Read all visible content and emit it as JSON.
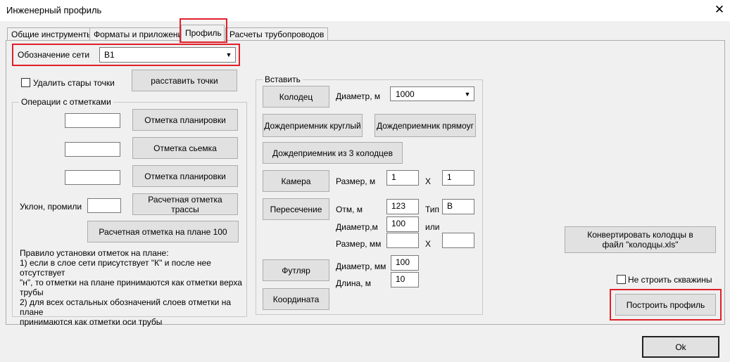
{
  "window": {
    "title": "Инженерный профиль",
    "close_glyph": "✕"
  },
  "tabs": [
    {
      "label": "Общие инструменты"
    },
    {
      "label": "Форматы и приложения"
    },
    {
      "label": "Профиль"
    },
    {
      "label": "Расчеты трубопроводов"
    }
  ],
  "network": {
    "label": "Обозначение сети",
    "value": "В1"
  },
  "top": {
    "delete_points_label": "Удалить стары точки",
    "place_points_button": "расставить точки"
  },
  "marks_group": {
    "legend": "Операции с отметками",
    "planning_button_1": "Отметка планировки",
    "survey_button": "Отметка сьемка",
    "planning_button_2": "Отметка планировки",
    "slope_label": "Уклон, промили",
    "calc_route_button": "Расчетная отметка трассы",
    "calc_plan_button": "Расчетная отметка на плане 100",
    "rule_lines": [
      "Правило установки отметок на плане:",
      "1) если в слое сети присутствует \"К\" и после нее отсутствует",
      "\"н\", то отметки на плане принимаются как отметки верха",
      "трубы",
      "2) для всех остальных обозначений слоев отметки на плане",
      "принимаются как отметки оси трубы"
    ]
  },
  "insert_group": {
    "legend": "Вставить",
    "well_button": "Колодец",
    "diameter_label": "Диаметр, м",
    "diameter_value": "1000",
    "rain_round_button": "Дождеприемник круглый",
    "rain_rect_button": "Дождеприемник прямоуг",
    "rain_three_button": "Дождеприемник из 3 колодцев",
    "chamber_button": "Камера",
    "size_label": "Размер, м",
    "size_a": "1",
    "x_label": "Х",
    "size_b": "1",
    "crossing_button": "Пересечение",
    "otm_label": "Отм, м",
    "otm_value": "123",
    "type_label": "Тип",
    "type_value": "В",
    "diam_m_label": "Диаметр,м",
    "diam_m_value": "100",
    "or_label": "или",
    "size_mm_label": "Размер, мм",
    "size_mm_a": "",
    "x_label_2": "Х",
    "size_mm_b": "",
    "case_button": "Футляр",
    "diam_mm_label": "Диаметр, мм",
    "diam_mm_value": "100",
    "length_label": "Длина, м",
    "length_value": "10",
    "coordinate_button": "Координата"
  },
  "right": {
    "convert_line1": "Конвертировать колодцы в",
    "convert_line2": "файл \"колодцы.xls\"",
    "no_wells_label": "Не строить скважины",
    "build_button": "Построить профиль"
  },
  "footer": {
    "ok_button": "Ok"
  },
  "colors": {
    "highlight": "#e0202a",
    "background": "#f0f0f0",
    "button": "#e1e1e1"
  }
}
